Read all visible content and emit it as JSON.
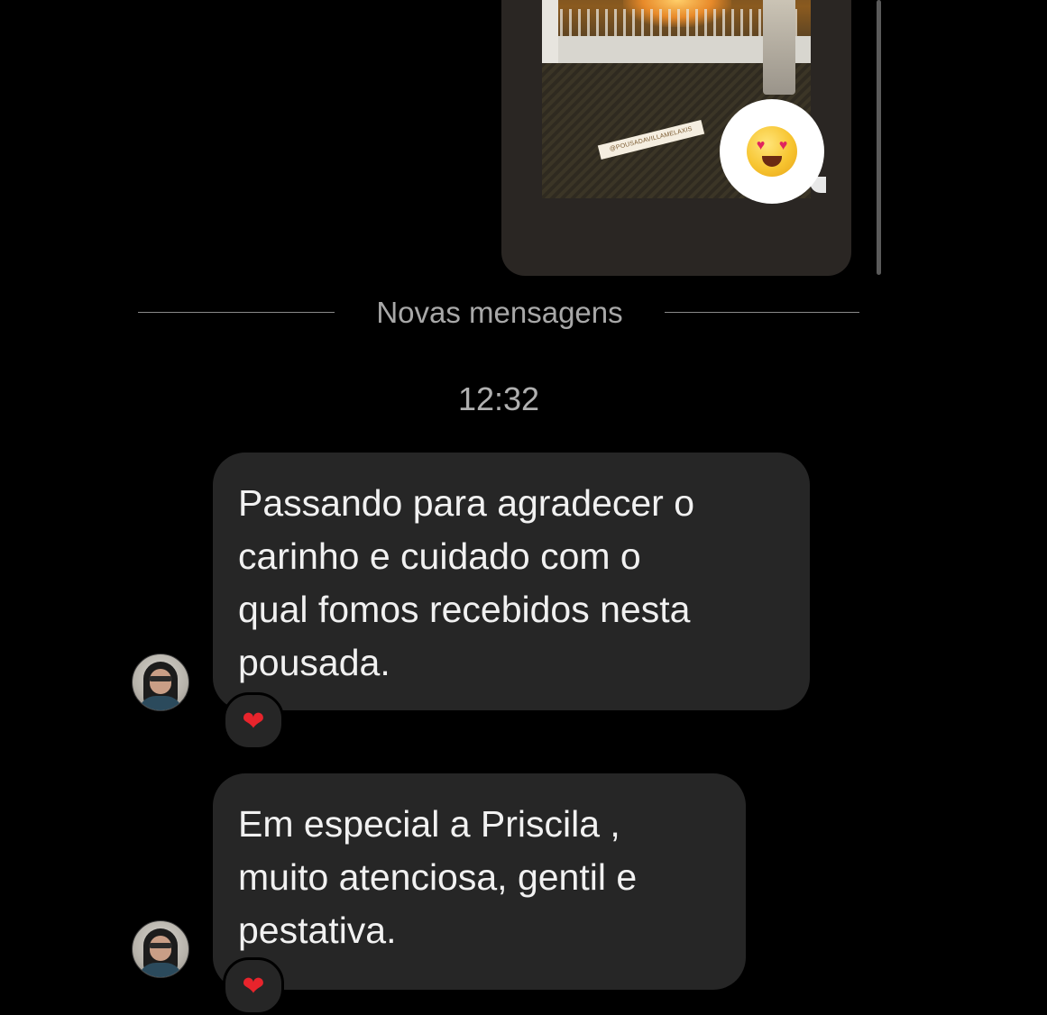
{
  "story": {
    "sticker_text": "@POUSADAVILLAMELAXIS",
    "reaction_emoji_name": "heart-eyes"
  },
  "divider": {
    "label": "Novas mensagens"
  },
  "timestamp": "12:32",
  "messages": [
    {
      "lines": [
        "Passando para agradecer o",
        "carinho e cuidado com o",
        "qual fomos recebidos nesta",
        "pousada."
      ],
      "reaction": "❤"
    },
    {
      "lines": [
        "Em especial a Priscila ,",
        "muito atenciosa, gentil e",
        "pestativa."
      ],
      "reaction": "❤"
    }
  ],
  "colors": {
    "background": "#000000",
    "bubble": "#262626",
    "text": "#f1f1f1",
    "muted": "#a8a8a8",
    "heart": "#e8242c"
  }
}
